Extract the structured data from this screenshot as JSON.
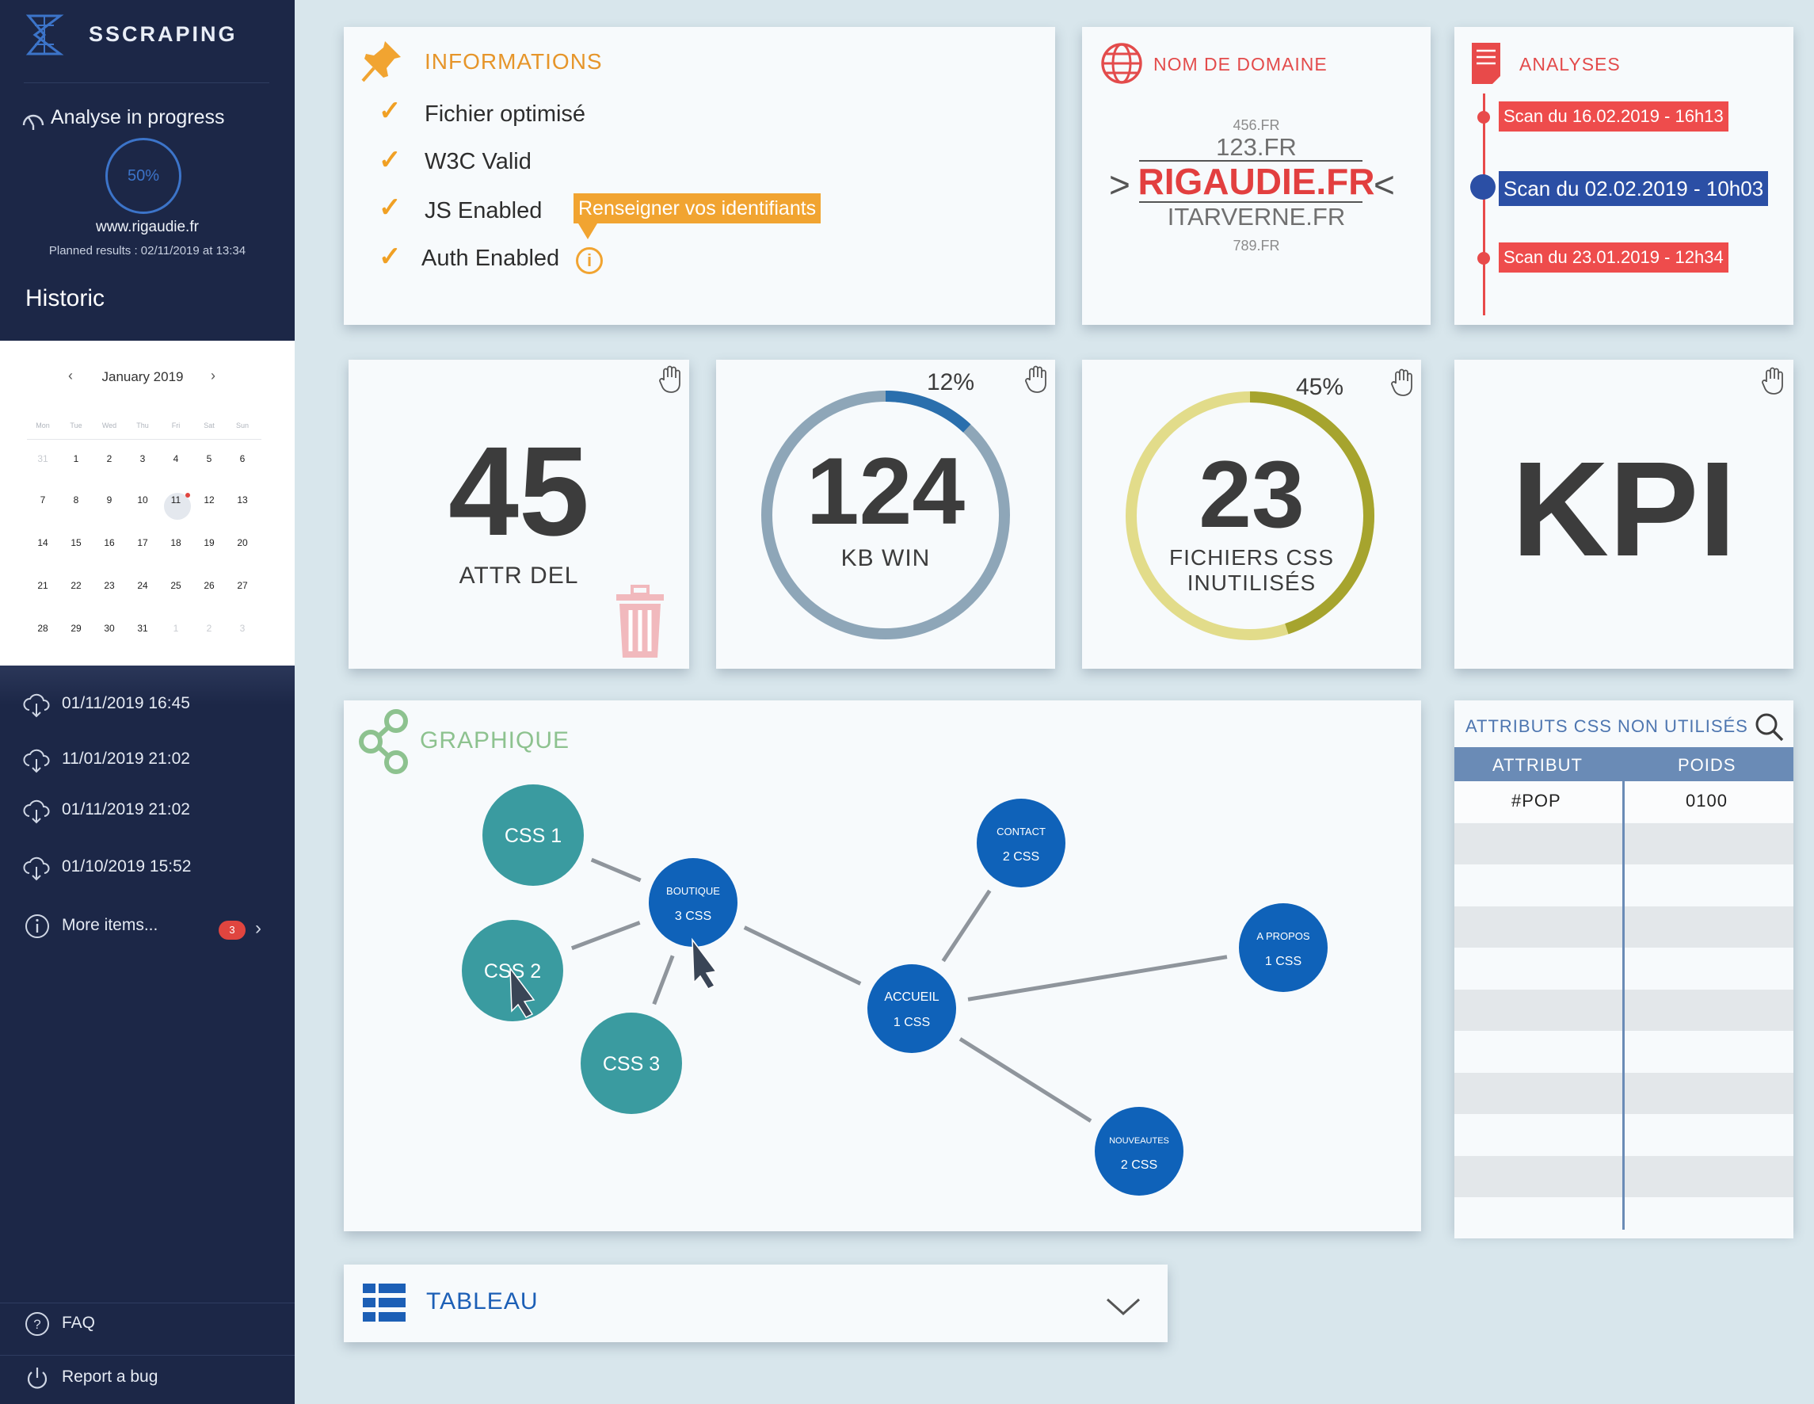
{
  "sidebar": {
    "brand": "SSCRAPING",
    "analysis_label": "Analyse in progress",
    "progress_text": "50%",
    "progress_value": 0.5,
    "site": "www.rigaudie.fr",
    "planned": "Planned results : 02/11/2019 at 13:34",
    "historic_title": "Historic",
    "calendar": {
      "month": "January 2019",
      "weekdays": [
        "Mon",
        "Tue",
        "Wed",
        "Thu",
        "Fri",
        "Sat",
        "Sun"
      ],
      "weeks": [
        [
          "31",
          "1",
          "2",
          "3",
          "4",
          "5",
          "6"
        ],
        [
          "7",
          "8",
          "9",
          "10",
          "11",
          "12",
          "13"
        ],
        [
          "14",
          "15",
          "16",
          "17",
          "18",
          "19",
          "20"
        ],
        [
          "21",
          "22",
          "23",
          "24",
          "25",
          "26",
          "27"
        ],
        [
          "28",
          "29",
          "30",
          "31",
          "1",
          "2",
          "3"
        ]
      ],
      "selected_day": "11"
    },
    "history": [
      {
        "label": "01/11/2019 16:45"
      },
      {
        "label": "11/01/2019 21:02"
      },
      {
        "label": "01/11/2019 21:02"
      },
      {
        "label": "01/10/2019 15:52"
      }
    ],
    "more_items": "More items...",
    "more_badge": "3",
    "faq": "FAQ",
    "report_bug": "Report a bug"
  },
  "informations": {
    "title": "INFORMATIONS",
    "items": [
      {
        "label": "Fichier optimisé"
      },
      {
        "label": "W3C Valid"
      },
      {
        "label": "JS Enabled"
      },
      {
        "label": "Auth Enabled"
      }
    ],
    "tooltip": "Renseigner vos identifiants",
    "info_glyph": "i"
  },
  "domain": {
    "title": "NOM DE DOMAINE",
    "top_small": "456.FR",
    "top": "123.FR",
    "main": "RIGAUDIE.FR",
    "bottom": "ITARVERNE.FR",
    "bottom_small": "789.FR"
  },
  "analyses": {
    "title": "ANALYSES",
    "scans": [
      {
        "label": "Scan du 16.02.2019 - 16h13",
        "color": "#ee4c4c"
      },
      {
        "label": "Scan du 02.02.2019 - 10h03",
        "color": "#2b4fa5"
      },
      {
        "label": "Scan du 23.01.2019 - 12h34",
        "color": "#ee4c4c"
      }
    ]
  },
  "kpis": [
    {
      "value": "45",
      "label": "ATTR DEL"
    },
    {
      "value": "124",
      "label": "KB WIN",
      "percent": "12%",
      "fraction": 0.12,
      "ring_color": "#8ea6b8",
      "fill_color": "#2a6fad"
    },
    {
      "value": "23",
      "label_1": "FICHIERS CSS",
      "label_2": "INUTILISÉS",
      "percent": "45%",
      "fraction": 0.45,
      "ring_color": "#e2dc8a",
      "fill_color": "#a6a42e"
    },
    {
      "value": "KPI"
    }
  ],
  "graph": {
    "title": "GRAPHIQUE",
    "nodes": [
      {
        "id": "css1",
        "lines": [
          "CSS 1"
        ],
        "kind": "teal"
      },
      {
        "id": "css2",
        "lines": [
          "CSS 2"
        ],
        "kind": "teal"
      },
      {
        "id": "css3",
        "lines": [
          "CSS 3"
        ],
        "kind": "teal"
      },
      {
        "id": "boutique",
        "lines": [
          "BOUTIQUE",
          "3 CSS"
        ],
        "kind": "blue"
      },
      {
        "id": "accueil",
        "lines": [
          "ACCUEIL",
          "1 CSS"
        ],
        "kind": "blue"
      },
      {
        "id": "contact",
        "lines": [
          "CONTACT",
          "2 CSS"
        ],
        "kind": "blue"
      },
      {
        "id": "apropos",
        "lines": [
          "A PROPOS",
          "1 CSS"
        ],
        "kind": "blue"
      },
      {
        "id": "nouveautes",
        "lines": [
          "NOUVEAUTES",
          "2 CSS"
        ],
        "kind": "blue"
      }
    ],
    "edges": [
      [
        "css1",
        "boutique"
      ],
      [
        "css2",
        "boutique"
      ],
      [
        "css3",
        "boutique"
      ],
      [
        "boutique",
        "accueil"
      ],
      [
        "accueil",
        "contact"
      ],
      [
        "accueil",
        "apropos"
      ],
      [
        "accueil",
        "nouveautes"
      ]
    ],
    "colors": {
      "teal": "#3a9ba0",
      "blue": "#0f62b9",
      "edge": "#8f959c"
    }
  },
  "css_table": {
    "title": "ATTRIBUTS CSS NON UTILISÉS",
    "columns": [
      "ATTRIBUT",
      "POIDS"
    ],
    "rows": [
      [
        "#POP",
        "0100"
      ]
    ]
  },
  "tableau": {
    "title": "TABLEAU"
  }
}
